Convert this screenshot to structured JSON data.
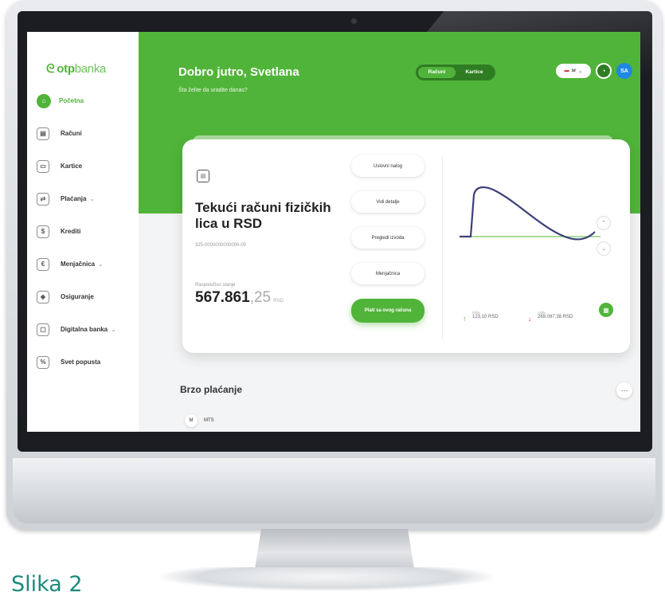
{
  "brand": {
    "logo_bold": "otp",
    "logo_light": "banka"
  },
  "sidebar": {
    "items": [
      {
        "label": "Početna",
        "icon": "home-icon",
        "active": true
      },
      {
        "label": "Računi",
        "icon": "wallet-icon",
        "chevron": ""
      },
      {
        "label": "Kartice",
        "icon": "card-icon",
        "chevron": ""
      },
      {
        "label": "Plaćanja",
        "icon": "payments-icon",
        "chevron": "⌄"
      },
      {
        "label": "Krediti",
        "icon": "credit-icon",
        "chevron": ""
      },
      {
        "label": "Menjačnica",
        "icon": "exchange-icon",
        "chevron": "⌄"
      },
      {
        "label": "Osiguranje",
        "icon": "shield-icon",
        "chevron": ""
      },
      {
        "label": "Digitalna banka",
        "icon": "monitor-icon",
        "chevron": "⌄"
      },
      {
        "label": "Svet popusta",
        "icon": "tag-icon",
        "chevron": ""
      }
    ]
  },
  "header": {
    "greeting": "Dobro jutro, Svetlana",
    "subtitle": "Šta želite da uradite danas?",
    "toggle": [
      "Računi",
      "Kartice"
    ],
    "lang": "sr",
    "avatar": "SA"
  },
  "account": {
    "title": "Tekući računi fizičkih lica u RSD",
    "number": "325-0000000000000-00",
    "balance_label": "Raspoloživo stanje",
    "balance_int": "567.861",
    "balance_dec": ",25",
    "currency": "RSD",
    "actions": [
      "Uslovni nalog",
      "Vidi detalje",
      "Pregledi izvoda",
      "Menjačnica"
    ],
    "primary_action": "Plati sa ovog računa"
  },
  "stats": {
    "in_label": "Priliv",
    "in_value": "123,10 RSD",
    "out_label": "Odliv",
    "out_value": "269.097,38 RSD"
  },
  "quick_pay": {
    "title": "Brzo plaćanje",
    "item": "MTS",
    "more": "···"
  },
  "caption": "Slika 2",
  "colors": {
    "brand_green": "#51b43a",
    "dark_green": "#2f7d22",
    "caption": "#1b8a7c",
    "line": "#3d3f7a"
  }
}
